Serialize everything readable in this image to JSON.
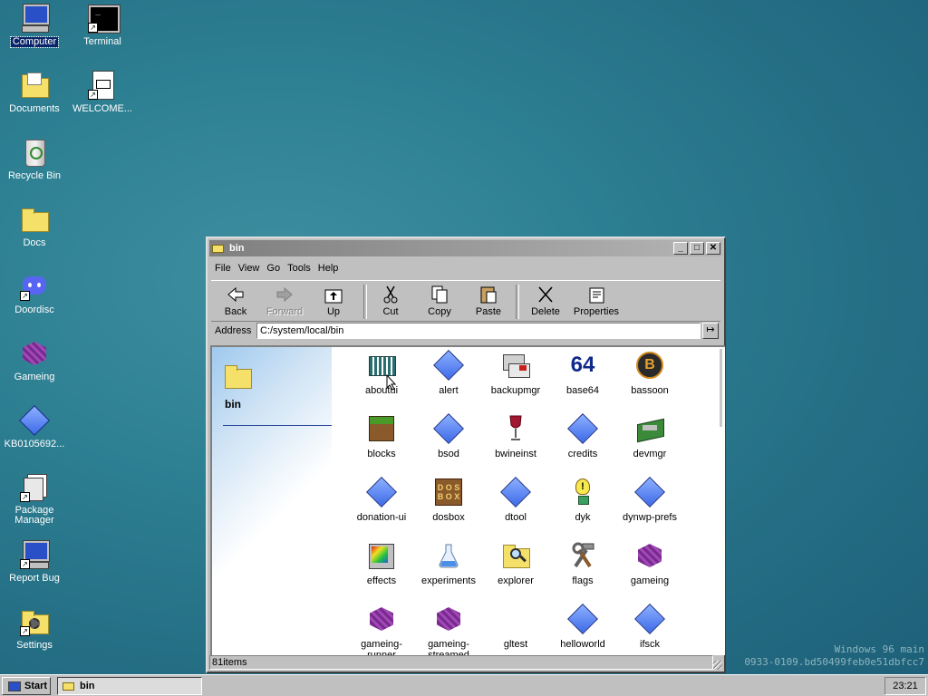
{
  "desktop": {
    "icons": [
      {
        "label": "Computer",
        "icon": "computer-icon"
      },
      {
        "label": "Terminal",
        "icon": "terminal-icon"
      },
      {
        "label": "Documents",
        "icon": "documents-folder-icon"
      },
      {
        "label": "WELCOME...",
        "icon": "markdown-file-icon"
      },
      {
        "label": "Recycle Bin",
        "icon": "recycle-bin-icon"
      },
      {
        "label": "Docs",
        "icon": "folder-icon"
      },
      {
        "label": "Doordisc",
        "icon": "discord-icon"
      },
      {
        "label": "Gameing",
        "icon": "purple-cube-icon"
      },
      {
        "label": "KB0105692...",
        "icon": "blue-diamond-icon"
      },
      {
        "label": "Package Manager",
        "icon": "package-manager-icon"
      },
      {
        "label": "Report Bug",
        "icon": "report-bug-icon"
      },
      {
        "label": "Settings",
        "icon": "settings-icon"
      }
    ]
  },
  "window": {
    "title": "bin",
    "menu": [
      "File",
      "View",
      "Go",
      "Tools",
      "Help"
    ],
    "toolbar": {
      "back": "Back",
      "forward": "Forward",
      "up": "Up",
      "cut": "Cut",
      "copy": "Copy",
      "paste": "Paste",
      "delete": "Delete",
      "properties": "Properties"
    },
    "address_label": "Address",
    "address_value": "C:/system/local/bin",
    "go_symbol": "↦",
    "sidepane_title": "bin",
    "files": [
      {
        "label": "aboutui",
        "icon": "aboutui-icon"
      },
      {
        "label": "alert",
        "icon": "blue-diamond-icon"
      },
      {
        "label": "backupmgr",
        "icon": "backup-icon"
      },
      {
        "label": "base64",
        "icon": "base64-icon"
      },
      {
        "label": "bassoon",
        "icon": "bassoon-icon"
      },
      {
        "label": "blocks",
        "icon": "grass-block-icon"
      },
      {
        "label": "bsod",
        "icon": "blue-diamond-icon"
      },
      {
        "label": "bwineinst",
        "icon": "wine-glass-icon"
      },
      {
        "label": "credits",
        "icon": "blue-diamond-icon"
      },
      {
        "label": "devmgr",
        "icon": "device-manager-icon"
      },
      {
        "label": "donation-ui",
        "icon": "blue-diamond-icon"
      },
      {
        "label": "dosbox",
        "icon": "dosbox-icon"
      },
      {
        "label": "dtool",
        "icon": "blue-diamond-icon"
      },
      {
        "label": "dyk",
        "icon": "lightbulb-icon"
      },
      {
        "label": "dynwp-prefs",
        "icon": "blue-diamond-icon"
      },
      {
        "label": "effects",
        "icon": "effects-icon"
      },
      {
        "label": "experiments",
        "icon": "flask-icon"
      },
      {
        "label": "explorer",
        "icon": "explorer-icon"
      },
      {
        "label": "flags",
        "icon": "tools-icon"
      },
      {
        "label": "gameing",
        "icon": "purple-cube-icon"
      },
      {
        "label": "gameing-runner",
        "icon": "purple-cube-icon"
      },
      {
        "label": "gameing-streamed",
        "icon": "purple-cube-icon"
      },
      {
        "label": "gltest",
        "icon": "blank-icon"
      },
      {
        "label": "helloworld",
        "icon": "blue-diamond-icon"
      },
      {
        "label": "ifsck",
        "icon": "blue-diamond-icon"
      }
    ],
    "status": "81items"
  },
  "taskbar": {
    "start": "Start",
    "task": "bin",
    "clock": "23:21"
  },
  "watermark": {
    "line1": "Windows 96 main",
    "line2": "0933-0109.bd50499feb0e51dbfcc7"
  }
}
